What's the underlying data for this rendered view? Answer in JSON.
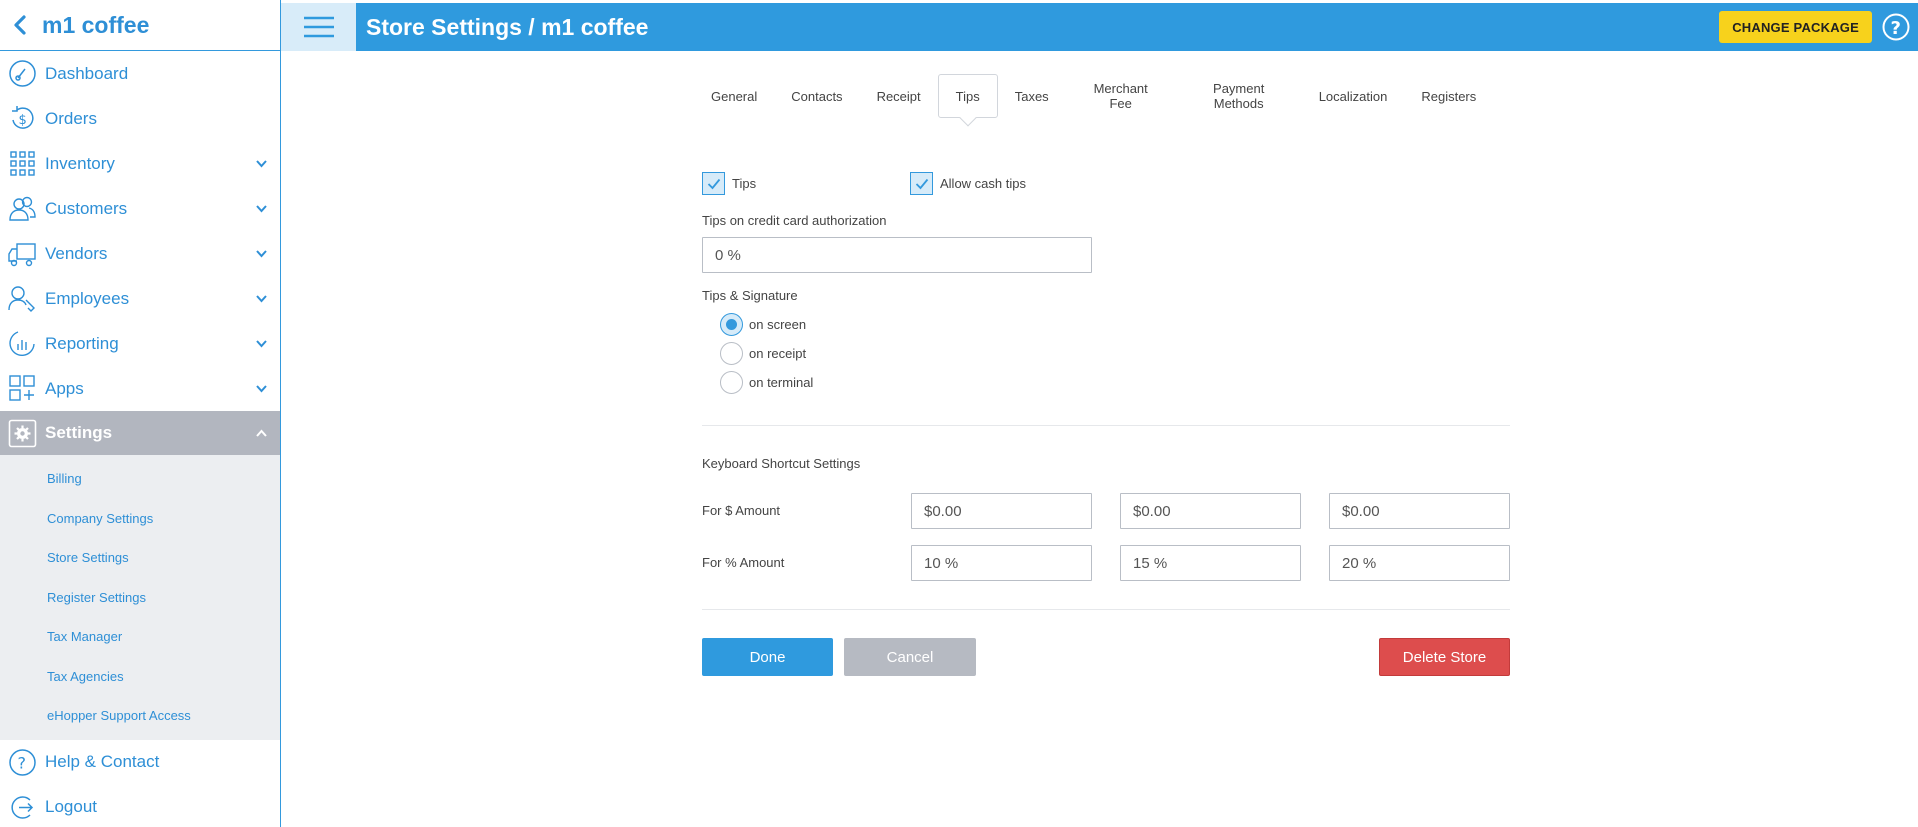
{
  "app": {
    "store_name": "m1 coffee"
  },
  "sidebar": {
    "items": [
      {
        "label": "Dashboard"
      },
      {
        "label": "Orders"
      },
      {
        "label": "Inventory"
      },
      {
        "label": "Customers"
      },
      {
        "label": "Vendors"
      },
      {
        "label": "Employees"
      },
      {
        "label": "Reporting"
      },
      {
        "label": "Apps"
      },
      {
        "label": "Settings"
      },
      {
        "label": "Help & Contact"
      },
      {
        "label": "Logout"
      }
    ],
    "settings_sub": [
      "Billing",
      "Company Settings",
      "Store Settings",
      "Register Settings",
      "Tax Manager",
      "Tax Agencies",
      "eHopper Support Access"
    ]
  },
  "header": {
    "title": "Store Settings / m1 coffee",
    "change_package": "CHANGE PACKAGE"
  },
  "tabs": [
    "General",
    "Contacts",
    "Receipt",
    "Tips",
    "Taxes",
    "Merchant Fee",
    "Payment Methods",
    "Localization",
    "Registers"
  ],
  "tabs_active": "Tips",
  "tips": {
    "tips_label": "Tips",
    "tips_checked": true,
    "cash_label": "Allow cash tips",
    "cash_checked": true,
    "credit_auth_label": "Tips on credit card authorization",
    "credit_auth_value": "0 %",
    "signature_label": "Tips & Signature",
    "signature_options": [
      "on screen",
      "on receipt",
      "on terminal"
    ],
    "signature_selected": "on screen"
  },
  "shortcuts": {
    "title": "Keyboard Shortcut Settings",
    "dollar_label": "For $ Amount",
    "dollar_values": [
      "$0.00",
      "$0.00",
      "$0.00"
    ],
    "percent_label": "For % Amount",
    "percent_values": [
      "10 %",
      "15 %",
      "20 %"
    ]
  },
  "actions": {
    "done": "Done",
    "cancel": "Cancel",
    "delete": "Delete Store"
  },
  "colors": {
    "primary": "#2f9ade",
    "header_bg": "#2f9ade",
    "accent_yellow": "#f7d21c",
    "danger": "#dd4d4d",
    "muted": "#b6bac2"
  }
}
